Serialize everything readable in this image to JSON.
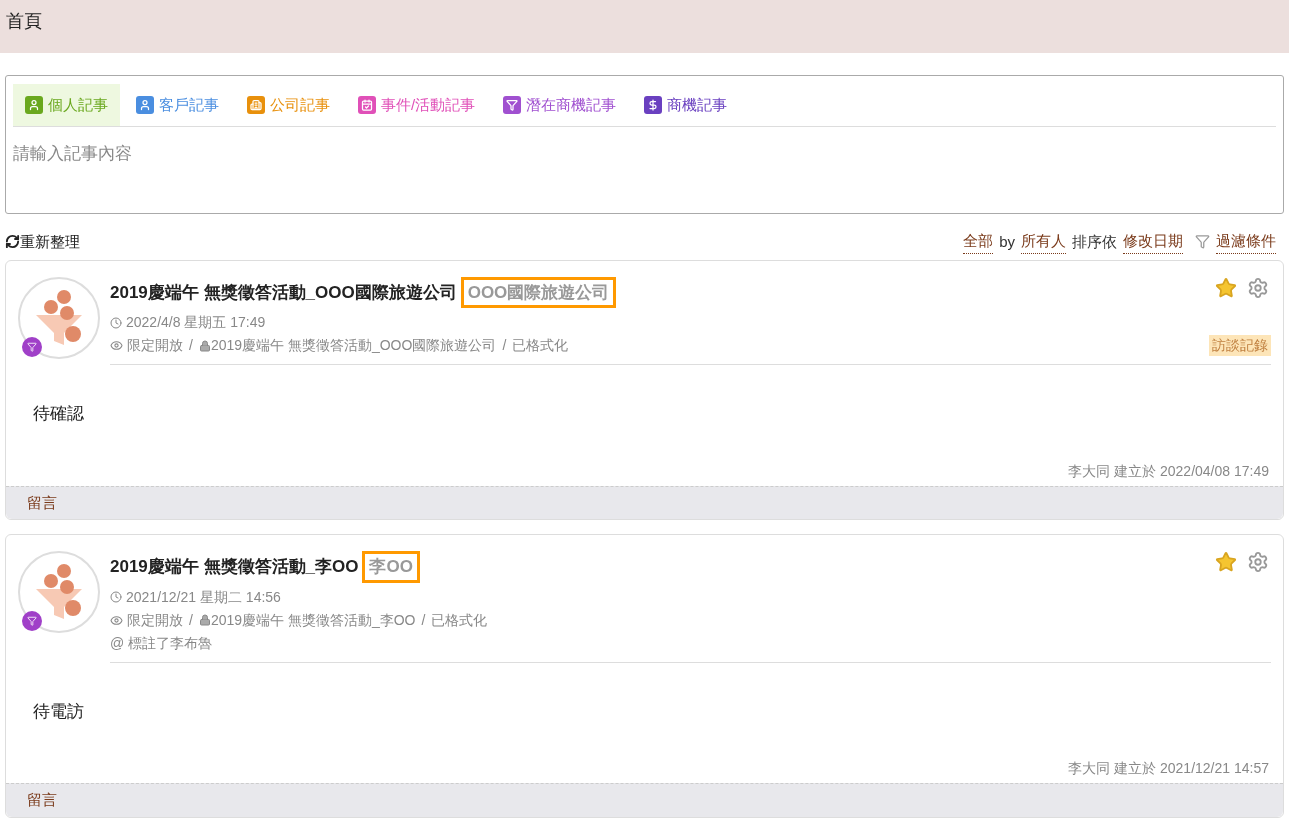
{
  "header": {
    "title": "首頁"
  },
  "composer": {
    "tabs": [
      {
        "label": "個人記事",
        "selected": true,
        "color": "#6aa81e",
        "kind": "person"
      },
      {
        "label": "客戶記事",
        "selected": false,
        "color": "#4a8ee0",
        "kind": "person"
      },
      {
        "label": "公司記事",
        "selected": false,
        "color": "#e8900c",
        "kind": "building"
      },
      {
        "label": "事件/活動記事",
        "selected": false,
        "color": "#e050b8",
        "kind": "calendar"
      },
      {
        "label": "潛在商機記事",
        "selected": false,
        "color": "#a050d0",
        "kind": "funnel"
      },
      {
        "label": "商機記事",
        "selected": false,
        "color": "#6a40c0",
        "kind": "dollar"
      }
    ],
    "placeholder": "請輸入記事內容"
  },
  "toolbar": {
    "refresh": "重新整理",
    "scope": "全部",
    "by": "by",
    "owner": "所有人",
    "sort_label": "排序依",
    "sort": "修改日期",
    "filter": "過濾條件"
  },
  "posts": [
    {
      "title": "2019慶端午 無獎徵答活動_OOO國際旅遊公司",
      "subject": "OOO國際旅遊公司",
      "highlighted": true,
      "starred": true,
      "datetime": "2022/4/8 星期五 17:49",
      "visibility": "限定開放",
      "path": "2019慶端午 無獎徵答活動_OOO國際旅遊公司",
      "separator": "/",
      "format": "已格式化",
      "tag": "訪談記錄",
      "body": "待確認",
      "footer": "李大同 建立於 2022/04/08 17:49",
      "comment": "留言"
    },
    {
      "title": "2019慶端午 無獎徵答活動_李OO",
      "subject": "李OO",
      "highlighted": true,
      "starred": true,
      "datetime": "2021/12/21 星期二 14:56",
      "visibility": "限定開放",
      "path": "2019慶端午 無獎徵答活動_李OO",
      "separator": "/",
      "format": "已格式化",
      "mention": "@ 標註了李布魯",
      "body": "待電訪",
      "footer": "李大同 建立於 2021/12/21 14:57",
      "comment": "留言"
    }
  ]
}
